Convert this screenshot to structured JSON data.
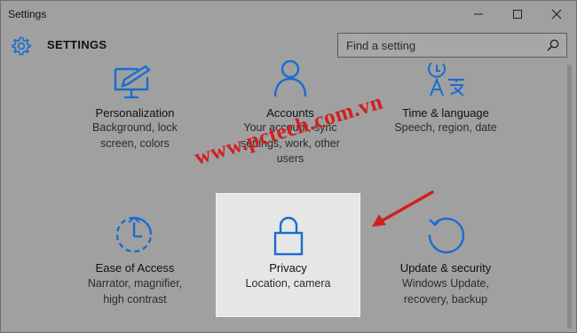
{
  "window": {
    "title": "Settings",
    "controls": {
      "minimize": "—",
      "maximize": "☐",
      "close": "✕"
    }
  },
  "header": {
    "title": "SETTINGS",
    "search_placeholder": "Find a setting"
  },
  "tiles": [
    {
      "name": "Personalization",
      "desc": [
        "Background, lock",
        "screen, colors"
      ],
      "icon": "personalization-icon"
    },
    {
      "name": "Accounts",
      "desc": [
        "Your account, sync",
        "settings, work, other",
        "users"
      ],
      "icon": "person-icon"
    },
    {
      "name": "Time & language",
      "desc": [
        "Speech, region, date"
      ],
      "icon": "time-language-icon"
    },
    {
      "name": "Ease of Access",
      "desc": [
        "Narrator, magnifier,",
        "high contrast"
      ],
      "icon": "ease-of-access-icon"
    },
    {
      "name": "Privacy",
      "desc": [
        "Location, camera"
      ],
      "icon": "lock-icon"
    },
    {
      "name": "Update & security",
      "desc": [
        "Windows Update,",
        "recovery, backup"
      ],
      "icon": "update-icon"
    }
  ],
  "watermark": "www.pctech.com.vn",
  "colors": {
    "accent": "#1a6ccf",
    "annotation": "#d21f1f",
    "highlight": "#e6e6e6"
  }
}
